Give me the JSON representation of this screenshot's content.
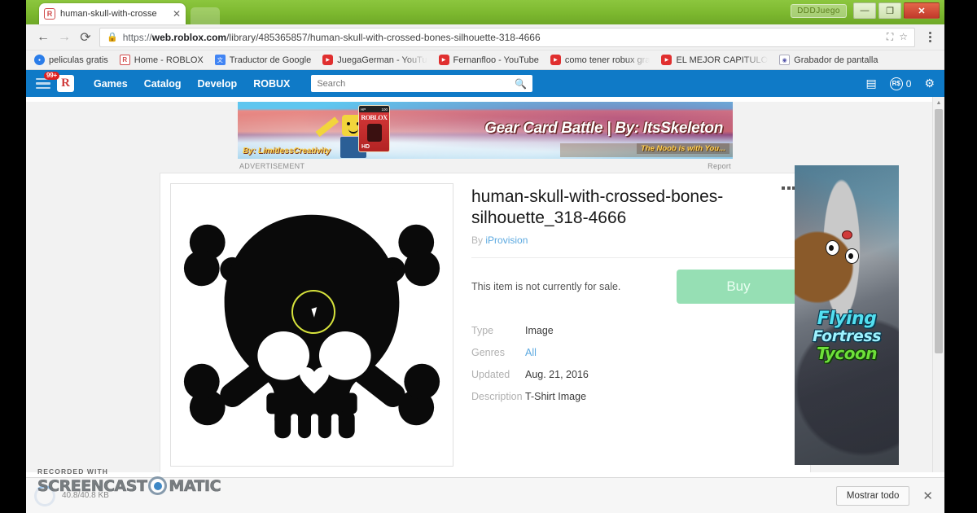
{
  "window": {
    "tab_title": "human-skull-with-crosse",
    "tab_favicon": "R",
    "extension_label": "DDDJuego",
    "minimize": "—",
    "maximize": "❐",
    "close": "✕"
  },
  "toolbar": {
    "back_icon": "←",
    "forward_icon": "→",
    "reload_icon": "⟳",
    "lock_icon": "🔒",
    "url_scheme": "https://",
    "url_host": "web.roblox.com",
    "url_path": "/library/485365857/human-skull-with-crossed-bones-silhouette-318-4666",
    "save_icon": "⛶",
    "star_icon": "☆",
    "menu_icon": "kebab-menu"
  },
  "bookmarks": [
    {
      "label": "peliculas gratis",
      "icon": "blue"
    },
    {
      "label": "Home - ROBLOX",
      "icon": "rb"
    },
    {
      "label": "Traductor de Google",
      "icon": "gt"
    },
    {
      "label": "JuegaGerman - YouTu",
      "icon": "yt",
      "truncated": true
    },
    {
      "label": "Fernanfloo - YouTube",
      "icon": "yt"
    },
    {
      "label": "como tener robux gra",
      "icon": "yt",
      "truncated": true
    },
    {
      "label": "EL MEJOR CAPITULO",
      "icon": "yt",
      "truncated": true
    },
    {
      "label": "Grabador de pantalla",
      "icon": "gray"
    }
  ],
  "roblox_nav": {
    "notification_badge": "99+",
    "logo": "R",
    "links": [
      "Games",
      "Catalog",
      "Develop",
      "ROBUX"
    ],
    "search_placeholder": "Search",
    "search_value": "",
    "search_icon": "search-icon",
    "list_icon": "list-icon",
    "robux_symbol": "R$",
    "robux_amount": "0",
    "gear_icon": "⚙"
  },
  "ad_banner": {
    "title": "Gear Card Battle | By: ItsSkeleton",
    "by_prefix": "By: ",
    "by_name": "LimitlessCreativity",
    "tagline": "The Noob is with You...",
    "card_brand": "ROBLOX",
    "card_hp": "HD",
    "card_top_left": "HP",
    "card_top_right": "100",
    "label": "ADVERTISEMENT",
    "report": "Report"
  },
  "item": {
    "title": "human-skull-with-crossed-bones-silhouette_318-4666",
    "by_label": "By",
    "creator": "iProvision",
    "sale_status": "This item is not currently for sale.",
    "buy_label": "Buy",
    "thumbnail_alt": "skull-with-crossbones-image",
    "details": [
      {
        "key": "Type",
        "value": "Image",
        "link": false
      },
      {
        "key": "Genres",
        "value": "All",
        "link": true
      },
      {
        "key": "Updated",
        "value": "Aug. 21, 2016",
        "link": false
      },
      {
        "key": "Description",
        "value": "T-Shirt Image",
        "link": false
      }
    ]
  },
  "side_ad": {
    "line1": "Flying",
    "line2": "Fortress",
    "line3": "Tycoon"
  },
  "download_shelf": {
    "file_name": "",
    "file_size": "40.8/40.8 KB",
    "show_all": "Mostrar todo",
    "close_icon": "✕"
  },
  "watermark": {
    "recorded_with": "RECORDED WITH",
    "word1": "SCREENCAST",
    "word2": "MATIC"
  },
  "colors": {
    "roblox_blue": "#0f7ac7",
    "buy_green": "#96dfb4",
    "link_blue": "#5ca9e0",
    "chrome_green": "#7cb82f",
    "cursor_ring": "#d6e23c"
  }
}
